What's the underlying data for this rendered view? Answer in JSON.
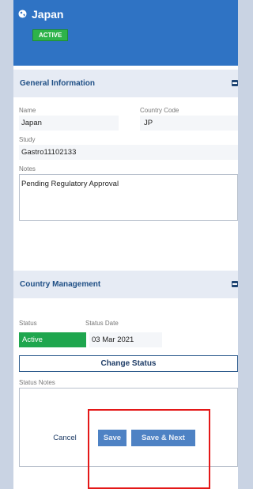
{
  "header": {
    "title": "Japan",
    "badge": "ACTIVE",
    "icon": "globe-icon"
  },
  "general": {
    "title": "General Information",
    "name_label": "Name",
    "name_value": "Japan",
    "country_code_label": "Country Code",
    "country_code_value": "JP",
    "study_label": "Study",
    "study_value": "Gastro11102133",
    "notes_label": "Notes",
    "notes_value": "Pending Regulatory Approval"
  },
  "management": {
    "title": "Country Management",
    "status_label": "Status",
    "status_value": "Active",
    "status_date_label": "Status Date",
    "status_date_value": "03 Mar 2021",
    "change_status_label": "Change Status",
    "status_notes_label": "Status Notes",
    "status_notes_value": ""
  },
  "footer": {
    "cancel_label": "Cancel",
    "save_label": "Save",
    "save_next_label": "Save & Next"
  },
  "colors": {
    "header_bg": "#2f73c4",
    "active_green": "#1fa64e",
    "button_blue": "#4e82c4",
    "highlight_red": "#e41818"
  }
}
